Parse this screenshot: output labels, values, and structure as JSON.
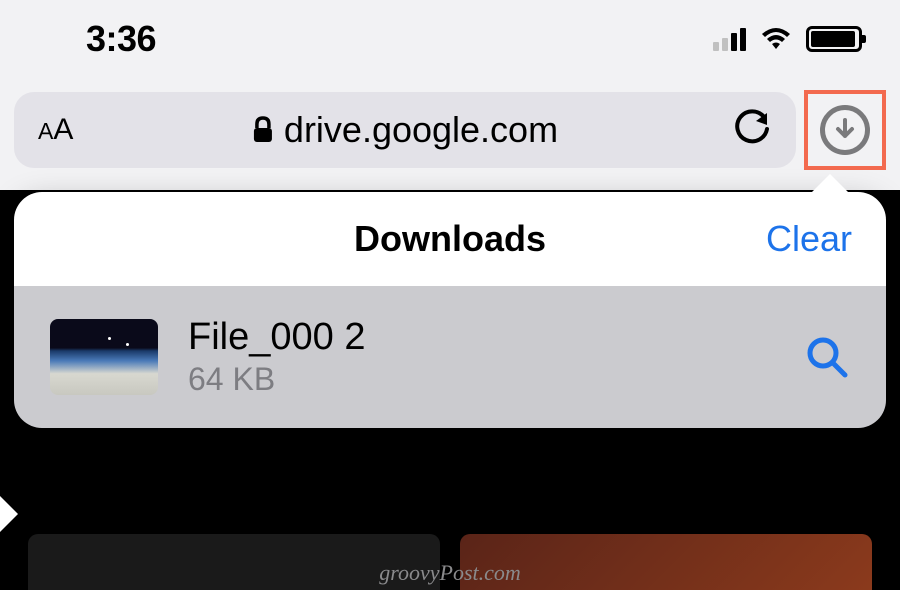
{
  "statusbar": {
    "time": "3:36"
  },
  "address": {
    "url": "drive.google.com"
  },
  "downloads": {
    "title": "Downloads",
    "clear_label": "Clear",
    "items": [
      {
        "name": "File_000 2",
        "size": "64 KB"
      }
    ]
  },
  "watermark": "groovyPost.com"
}
